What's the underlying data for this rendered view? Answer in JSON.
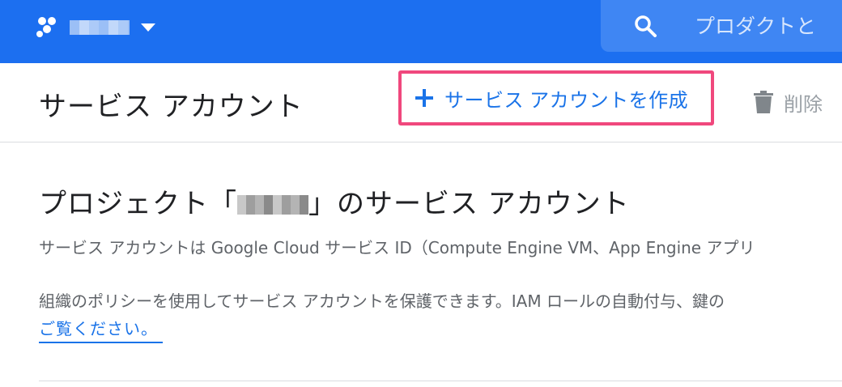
{
  "header": {
    "project_name": "",
    "search_placeholder": "プロダクトと",
    "colors": {
      "bar": "#1c6ff0",
      "search": "#3f86f3"
    }
  },
  "toolbar": {
    "title": "サービス アカウント",
    "create_label": "サービス アカウントを作成",
    "delete_label": "削除",
    "highlight_color": "#f0487d"
  },
  "main": {
    "heading_prefix": "プロジェクト「",
    "heading_suffix": "」のサービス アカウント",
    "description_1": "サービス アカウントは Google Cloud サービス ID（Compute Engine VM、App Engine アプリ",
    "description_2": "組織のポリシーを使用してサービス アカウントを保護できます。IAM ロールの自動付与、鍵の",
    "link_text": "ご覧ください。"
  },
  "icons": [
    "hexagon-logo-icon",
    "chevron-down-icon",
    "search-icon",
    "plus-icon",
    "trash-icon"
  ]
}
